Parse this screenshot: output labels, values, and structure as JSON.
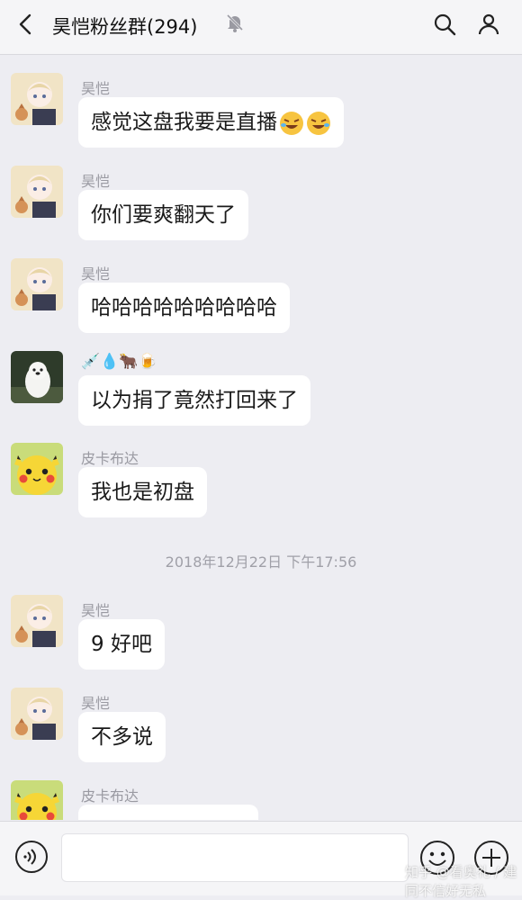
{
  "header": {
    "title": "昊恺粉丝群(294)"
  },
  "timestamp": "2018年12月22日 下午17:56",
  "messages": [
    {
      "sender": "昊恺",
      "text": "感觉这盘我要是直播"
    },
    {
      "sender": "昊恺",
      "text": "你们要爽翻天了"
    },
    {
      "sender": "昊恺",
      "text": "哈哈哈哈哈哈哈哈哈"
    },
    {
      "sender": "💉💧🐂🍺",
      "text": "以为捐了竟然打回来了"
    },
    {
      "sender": "皮卡布达",
      "text": "我也是初盘"
    },
    {
      "sender": "昊恺",
      "text": "9 好吧"
    },
    {
      "sender": "昊恺",
      "text": "不多说"
    },
    {
      "sender": "皮卡布达",
      "text": ""
    }
  ],
  "input": {
    "placeholder": ""
  },
  "watermark": "知乎 @看奥礼 / 建同不信好无私",
  "colors": {
    "background": "#ededf2",
    "bubble": "#ffffff",
    "header": "#f5f5f7"
  }
}
